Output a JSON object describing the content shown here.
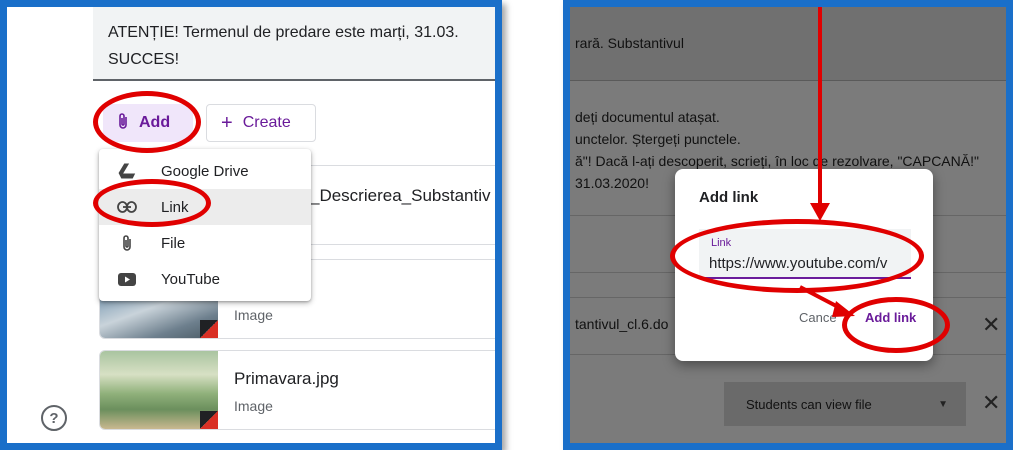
{
  "left": {
    "instructions": {
      "line1": "ATENȚIE! Termenul de predare este marți, 31.03.",
      "line2": "SUCCES!"
    },
    "add_button": {
      "icon": "paperclip-icon",
      "label": "Add"
    },
    "create_button": {
      "icon": "plus-icon",
      "label": "Create"
    },
    "menu": [
      {
        "icon": "google-drive-icon",
        "label": "Google Drive"
      },
      {
        "icon": "link-icon",
        "label": "Link"
      },
      {
        "icon": "paperclip-icon",
        "label": "File"
      },
      {
        "icon": "youtube-icon",
        "label": "YouTube"
      }
    ],
    "attachments": [
      {
        "title": "_Descrierea_Substantiv",
        "subtitle": ""
      },
      {
        "title": "",
        "subtitle": "Image"
      },
      {
        "title": "Primavara.jpg",
        "subtitle": "Image"
      }
    ],
    "help_icon": "help-icon"
  },
  "right": {
    "title": "rară. Substantivul",
    "text_lines": [
      "deți documentul atașat.",
      "unctelor. Ștergeți punctele.",
      "ă\"! Dacă l-ați descoperit, scrieți, în loc de rezolvare, \"CAPCANĂ!\"",
      "31.03.2020!"
    ],
    "attachment_row": "tantivul_cl.6.do",
    "dialog": {
      "title": "Add link",
      "field_label": "Link",
      "field_value": "https://www.youtube.com/v",
      "cancel_label": "Cance",
      "add_label": "Add link"
    },
    "students_select": "Students can view file",
    "close_symbol": "✕"
  },
  "colors": {
    "frame": "#1a6fc9",
    "annotation": "#e00000",
    "accent": "#6a1b9a"
  }
}
